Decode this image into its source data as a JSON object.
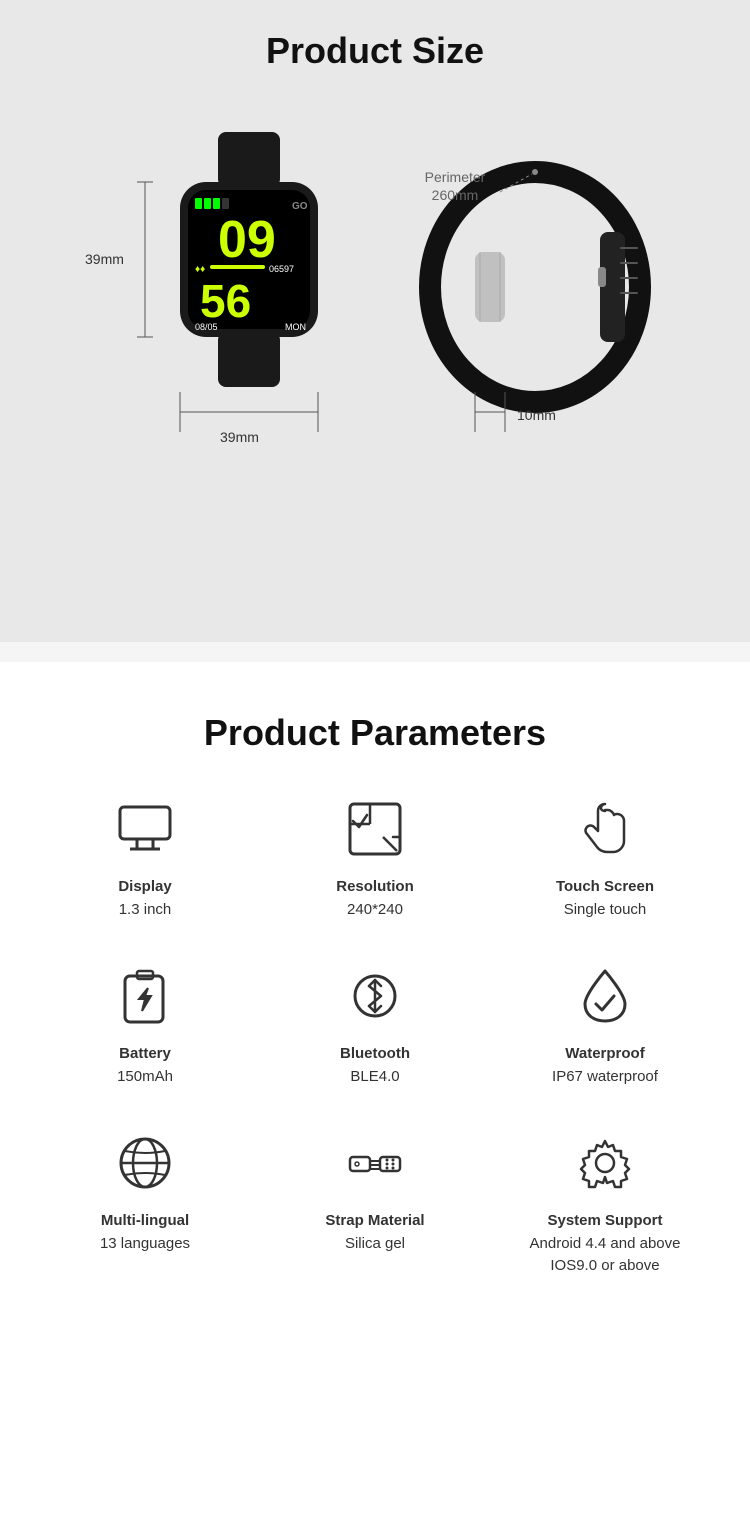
{
  "product_size": {
    "title": "Product Size",
    "watch": {
      "hour": "09",
      "minute": "56",
      "date": "08/05",
      "day": "MON",
      "steps": "06597"
    },
    "dimensions": {
      "height": "39mm",
      "width": "39mm",
      "depth": "10mm",
      "perimeter": "Perimeter\n260mm"
    }
  },
  "product_params": {
    "title": "Product Parameters",
    "items": [
      {
        "icon": "display",
        "label": "Display",
        "value": "1.3 inch"
      },
      {
        "icon": "resolution",
        "label": "Resolution",
        "value": "240*240"
      },
      {
        "icon": "touch",
        "label": "Touch Screen",
        "value": "Single touch"
      },
      {
        "icon": "battery",
        "label": "Battery",
        "value": "150mAh"
      },
      {
        "icon": "bluetooth",
        "label": "Bluetooth",
        "value": "BLE4.0"
      },
      {
        "icon": "waterproof",
        "label": "Waterproof",
        "value": "IP67 waterproof"
      },
      {
        "icon": "language",
        "label": "Multi-lingual",
        "value": "13 languages"
      },
      {
        "icon": "strap",
        "label": "Strap Material",
        "value": "Silica gel"
      },
      {
        "icon": "system",
        "label": "System Support",
        "value": "Android 4.4 and above\nIOS9.0 or above"
      }
    ]
  }
}
